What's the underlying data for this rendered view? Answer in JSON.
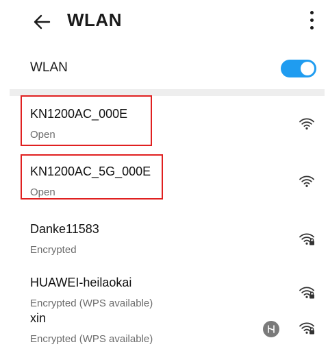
{
  "header": {
    "title": "WLAN"
  },
  "wlan": {
    "label": "WLAN",
    "enabled": true,
    "accent": "#1f9cf0"
  },
  "networks": [
    {
      "name": "KN1200AC_000E",
      "status": "Open",
      "secured": false,
      "wps": false,
      "highlighted": true
    },
    {
      "name": "KN1200AC_5G_000E",
      "status": "Open",
      "secured": false,
      "wps": false,
      "highlighted": true
    },
    {
      "name": "Danke11583",
      "status": "Encrypted",
      "secured": true,
      "wps": false,
      "highlighted": false
    },
    {
      "name": "HUAWEI-heilaokai",
      "status": "Encrypted (WPS available)",
      "secured": true,
      "wps": false,
      "highlighted": false
    },
    {
      "name": "xin",
      "status": "Encrypted (WPS available)",
      "secured": true,
      "wps": true,
      "highlighted": false
    }
  ],
  "icons": {
    "back": "arrow-left-icon",
    "menu": "more-vertical-icon",
    "wifi": "wifi-icon",
    "wifi_locked": "wifi-lock-icon",
    "wps": "wps-icon"
  },
  "highlight_color": "#e02020"
}
